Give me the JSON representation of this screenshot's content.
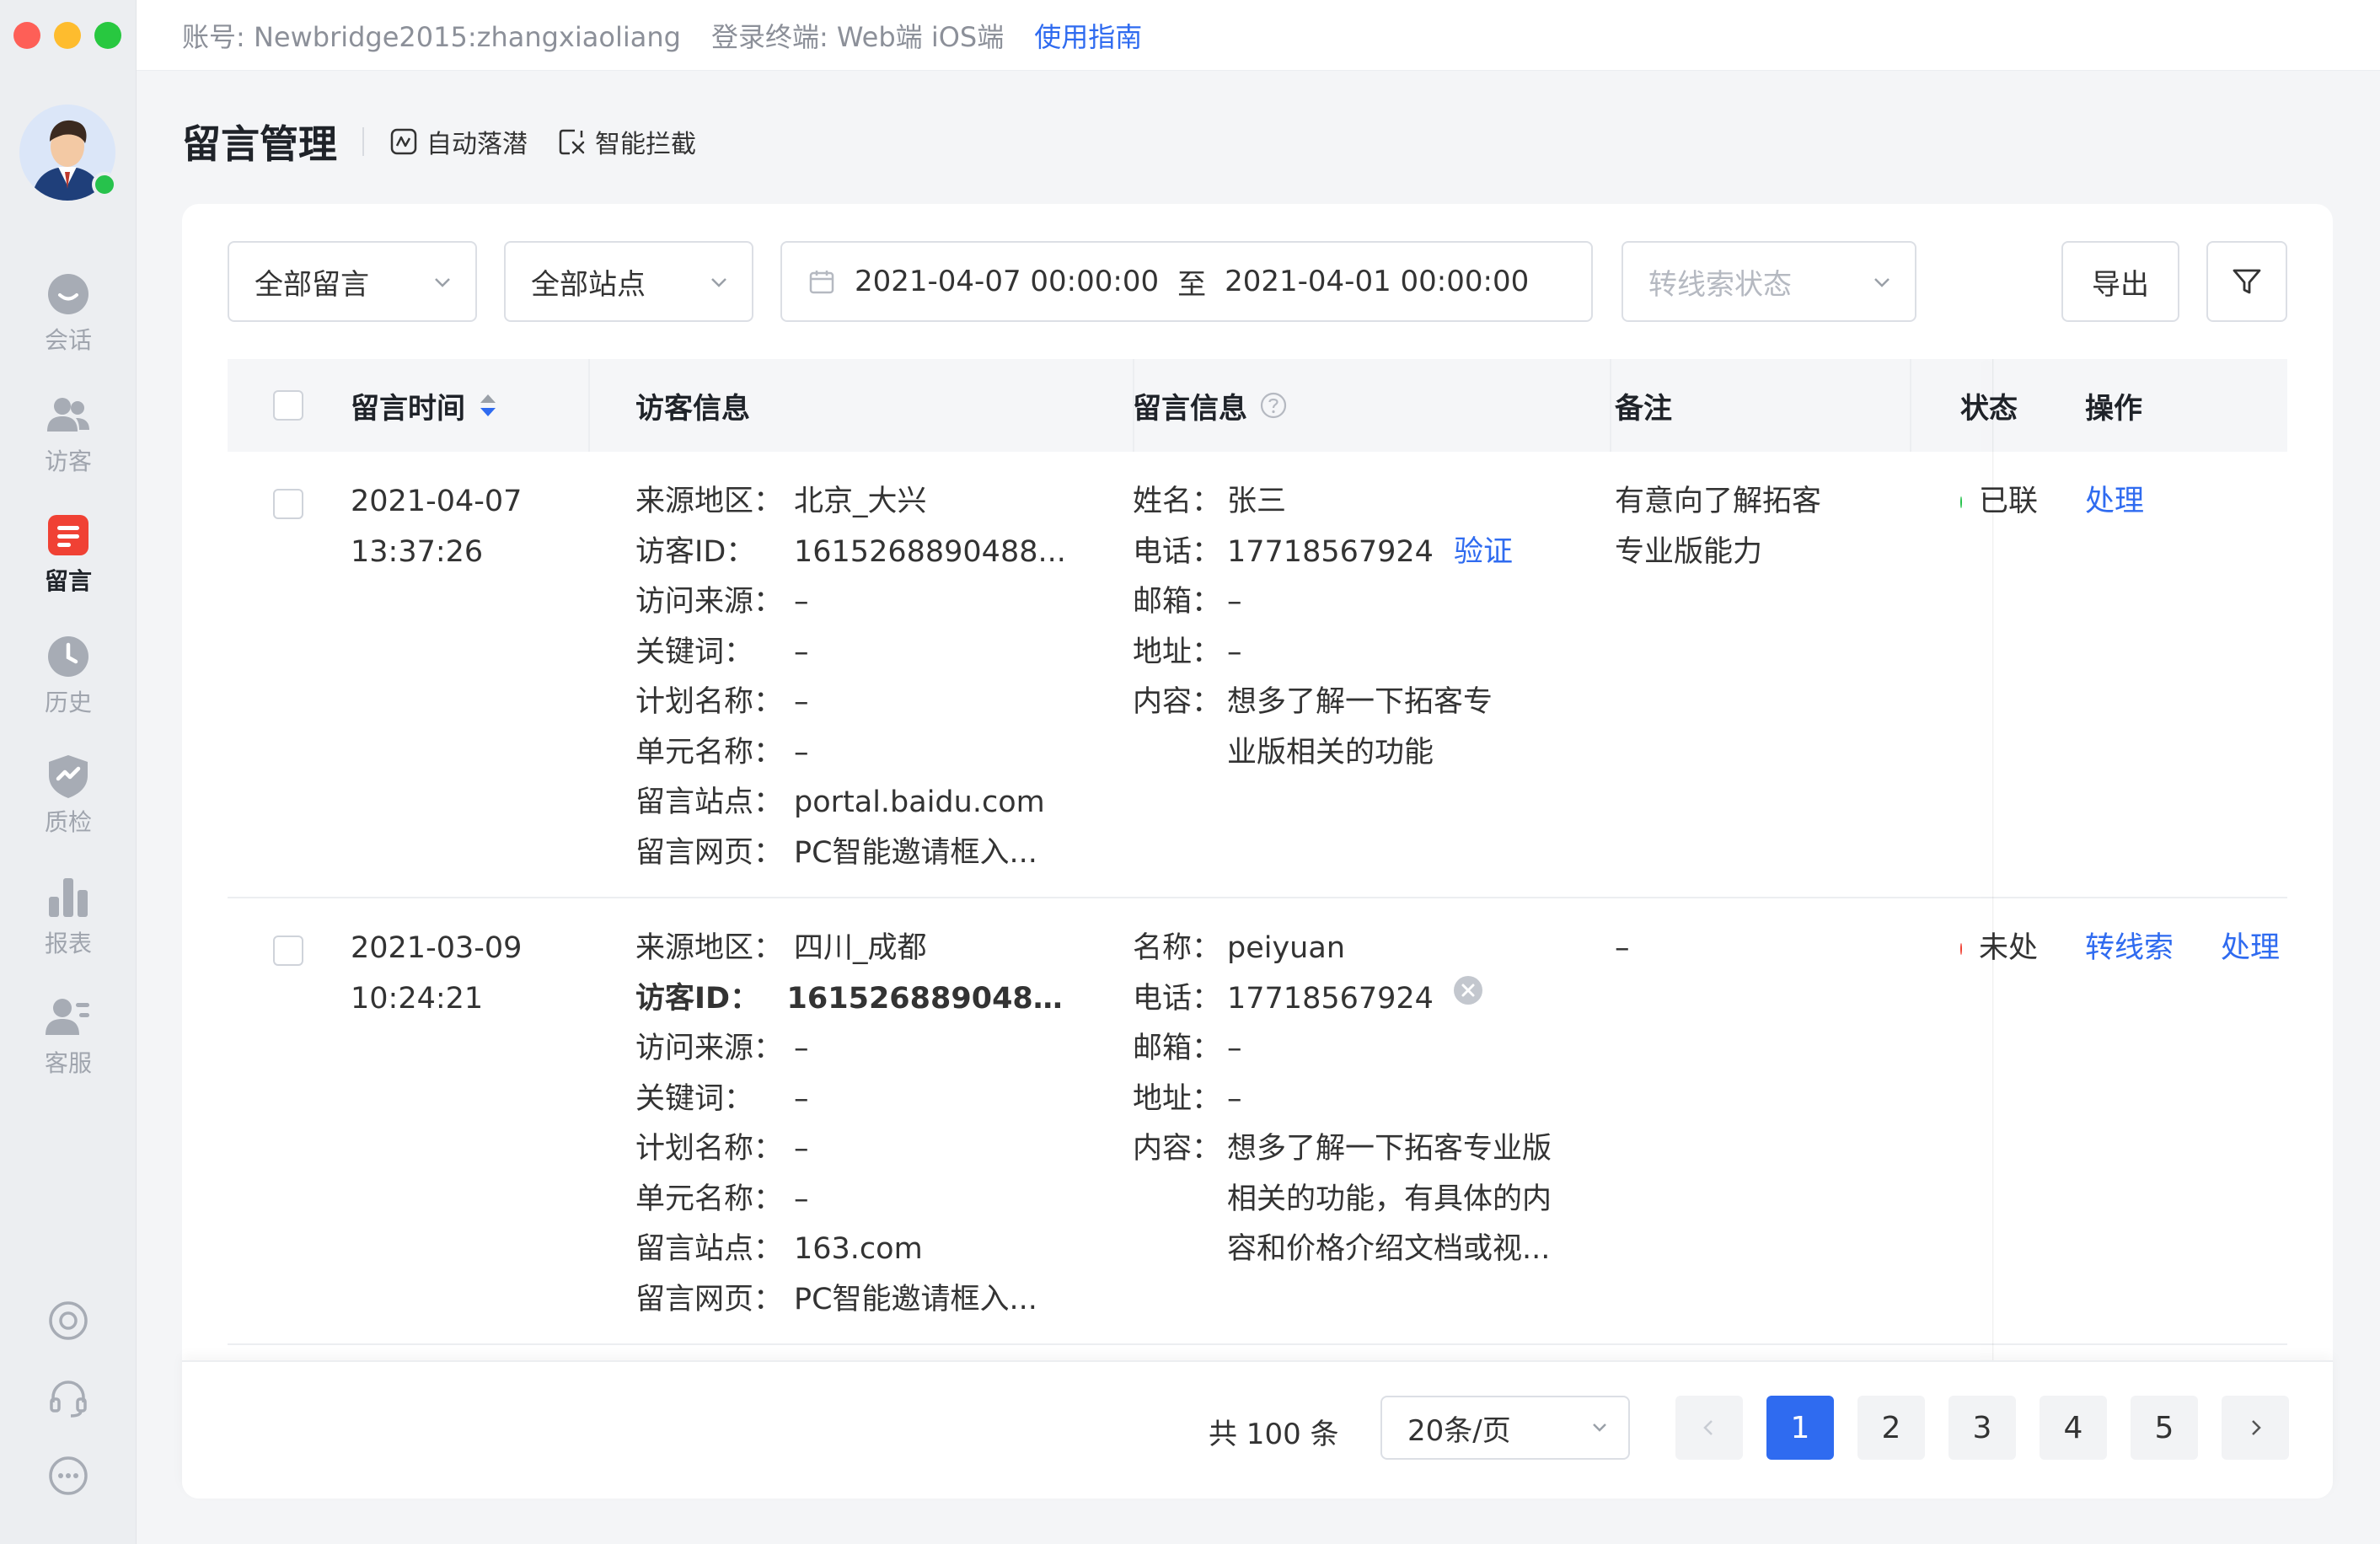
{
  "topbar": {
    "account": "账号: Newbridge2015:zhangxiaoliang",
    "terminals": "登录终端: Web端  iOS端",
    "guide": "使用指南"
  },
  "sidebar": {
    "items": [
      {
        "label": "会话",
        "icon": "chat-icon"
      },
      {
        "label": "访客",
        "icon": "visitors-icon"
      },
      {
        "label": "留言",
        "icon": "message-icon",
        "active": true
      },
      {
        "label": "历史",
        "icon": "history-clock-icon"
      },
      {
        "label": "质检",
        "icon": "quality-shield-icon"
      },
      {
        "label": "报表",
        "icon": "report-bars-icon"
      },
      {
        "label": "客服",
        "icon": "agent-icon"
      }
    ]
  },
  "header": {
    "title": "留言管理",
    "auto_sink": "自动落潜",
    "smart_block": "智能拦截"
  },
  "filters": {
    "message_type": "全部留言",
    "site": "全部站点",
    "date_start": "2021-04-07 00:00:00",
    "date_sep": "至",
    "date_end": "2021-04-01 00:00:00",
    "lead_status_placeholder": "转线索状态",
    "export": "导出"
  },
  "table": {
    "columns": {
      "time": "留言时间",
      "visitor": "访客信息",
      "message": "留言信息",
      "remark": "备注",
      "status": "状态",
      "ops": "操作"
    },
    "rows": [
      {
        "date": "2021-04-07",
        "time": "13:37:26",
        "visitor": [
          {
            "k": "来源地区：",
            "v": "北京_大兴"
          },
          {
            "k": "访客ID：",
            "v": "1615268890488..."
          },
          {
            "k": "访问来源：",
            "v": "–"
          },
          {
            "k": "关键词：",
            "v": "–"
          },
          {
            "k": "计划名称：",
            "v": "–"
          },
          {
            "k": "单元名称：",
            "v": "–"
          },
          {
            "k": "留言站点：",
            "v": "portal.baidu.com"
          },
          {
            "k": "留言网页：",
            "v": "PC智能邀请框入..."
          }
        ],
        "msg_name_k": "姓名：",
        "msg_name_v": "张三",
        "msg_phone_k": "电话：",
        "msg_phone_v": "17718567924",
        "msg_phone_action": "验证",
        "msg_email_k": "邮箱：",
        "msg_email_v": "–",
        "msg_addr_k": "地址：",
        "msg_addr_v": "–",
        "msg_content_k": "内容：",
        "msg_content_1": "想多了解一下拓客专",
        "msg_content_2": "业版相关的功能",
        "remark_1": "有意向了解拓客",
        "remark_2": "专业版能力",
        "status": "已联",
        "status_color": "#27c24c",
        "op1": "处理"
      },
      {
        "date": "2021-03-09",
        "time": "10:24:21",
        "visitor": [
          {
            "k": "来源地区：",
            "v": "四川_成都"
          },
          {
            "k": "访客ID：",
            "v": "1615268890488..."
          },
          {
            "k": "访问来源：",
            "v": "–"
          },
          {
            "k": "关键词：",
            "v": "–"
          },
          {
            "k": "计划名称：",
            "v": "–"
          },
          {
            "k": "单元名称：",
            "v": "–"
          },
          {
            "k": "留言站点：",
            "v": "163.com"
          },
          {
            "k": "留言网页：",
            "v": "PC智能邀请框入..."
          }
        ],
        "msg_name_k": "名称：",
        "msg_name_v": "peiyuan",
        "msg_phone_k": "电话：",
        "msg_phone_v": "17718567924",
        "msg_email_k": "邮箱：",
        "msg_email_v": "–",
        "msg_addr_k": "地址：",
        "msg_addr_v": "–",
        "msg_content_k": "内容：",
        "msg_content_1": "想多了解一下拓客专业版",
        "msg_content_2": "相关的功能，有具体的内",
        "msg_content_3": "容和价格介绍文档或视...",
        "remark_1": "–",
        "status": "未处",
        "status_color": "#f04134",
        "op1": "转线索",
        "op2": "处理"
      }
    ]
  },
  "pagination": {
    "total": "共 100 条",
    "page_size": "20条/页",
    "pages": [
      "1",
      "2",
      "3",
      "4",
      "5"
    ],
    "current": "1"
  },
  "colors": {
    "accent": "#2f6bf0",
    "online": "#27c24c",
    "danger": "#f04134"
  }
}
